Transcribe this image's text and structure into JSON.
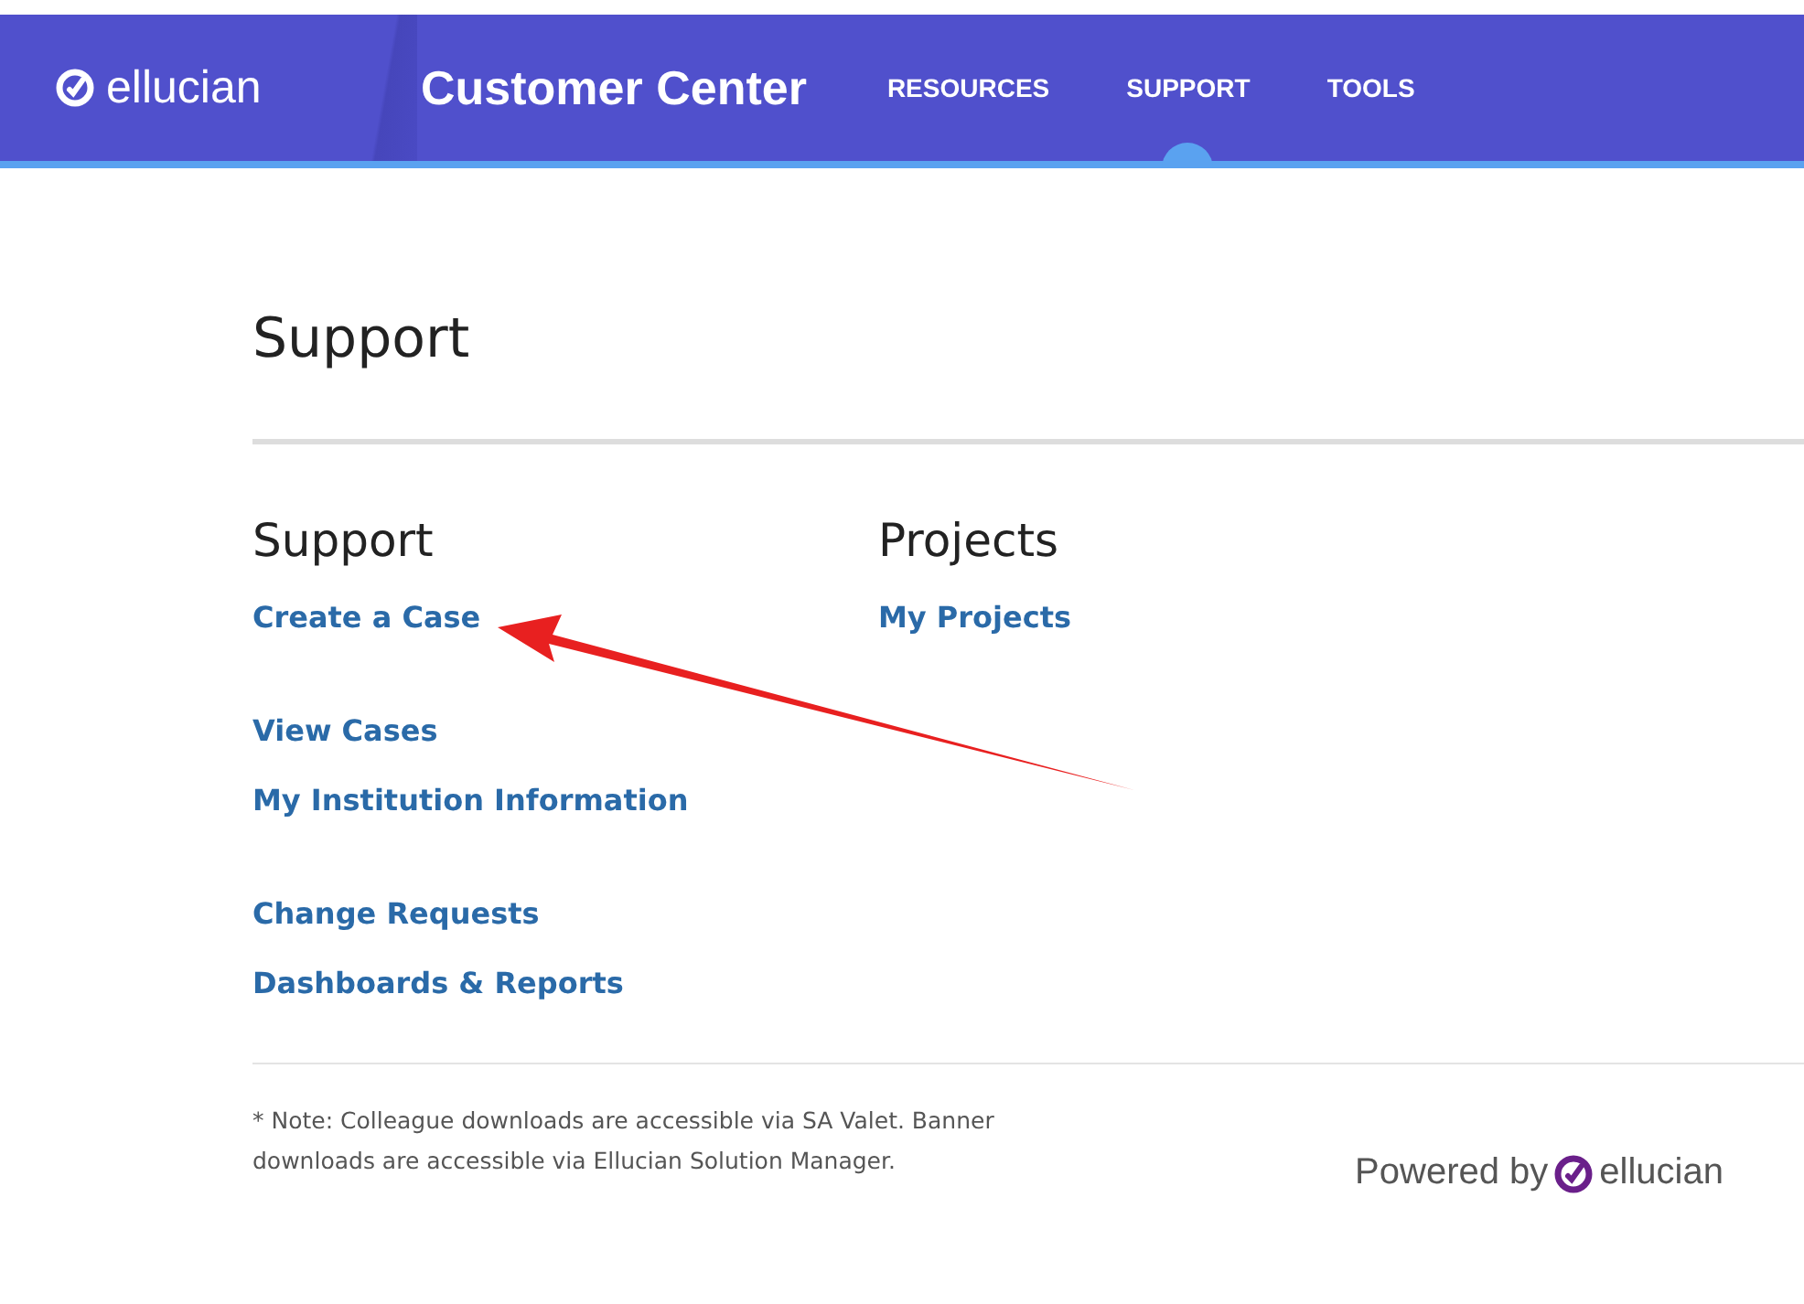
{
  "header": {
    "logo_text": "ellucian",
    "title": "Customer Center",
    "nav": [
      {
        "label": "RESOURCES",
        "selected": false
      },
      {
        "label": "SUPPORT",
        "selected": true
      },
      {
        "label": "TOOLS",
        "selected": false
      }
    ]
  },
  "page_title": "Support",
  "columns": [
    {
      "heading": "Support",
      "groups": [
        [
          "Create a Case"
        ],
        [
          "View Cases",
          "My Institution Information"
        ],
        [
          "Change Requests",
          "Dashboards & Reports"
        ]
      ]
    },
    {
      "heading": "Projects",
      "groups": [
        [
          "My Projects"
        ]
      ]
    }
  ],
  "footer": {
    "note": "* Note: Colleague downloads are accessible via SA Valet. Banner downloads are accessible via Ellucian Solution Manager.",
    "powered_by": "Powered by",
    "logo_text": "ellucian"
  }
}
